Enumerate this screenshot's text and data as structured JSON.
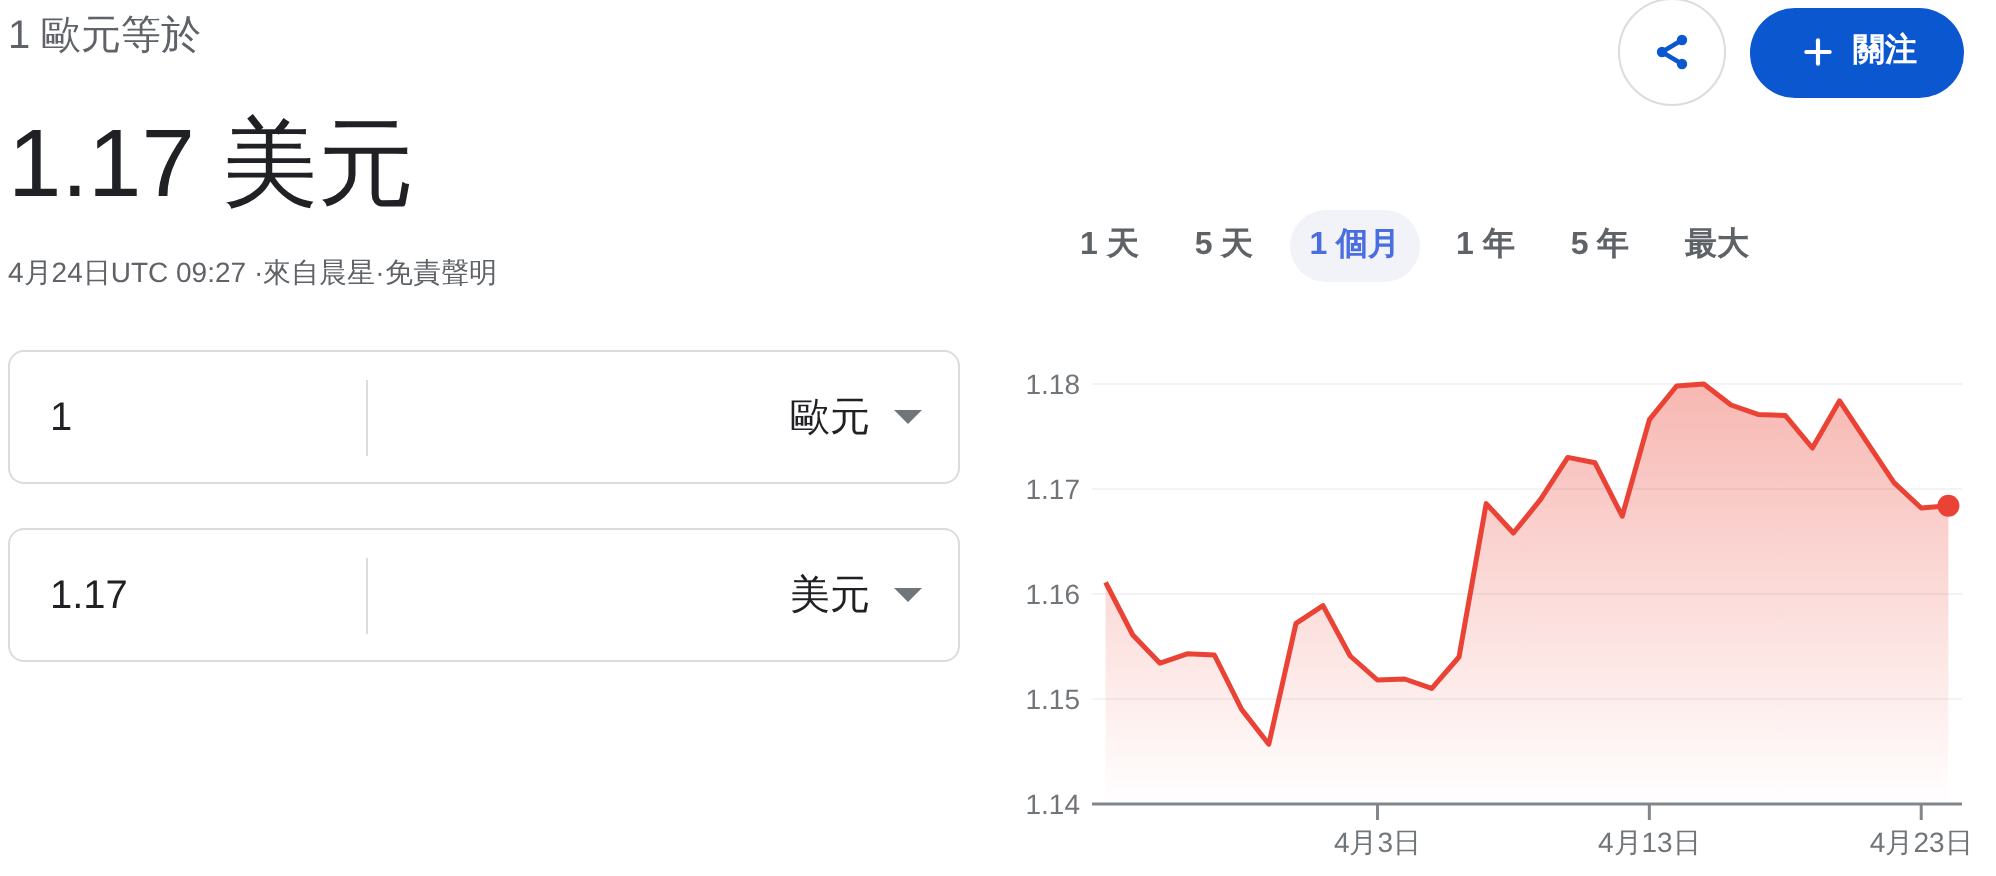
{
  "header": {
    "base_label": "1 歐元等於",
    "result": "1.17 美元",
    "meta": "4月24日UTC 09:27 ·來自晨星·免責聲明"
  },
  "actions": {
    "follow_button": "關注"
  },
  "converter": [
    {
      "amount": "1",
      "currency": "歐元"
    },
    {
      "amount": "1.17",
      "currency": "美元"
    }
  ],
  "ranges": [
    {
      "label": "1 天",
      "selected": false
    },
    {
      "label": "5 天",
      "selected": false
    },
    {
      "label": "1 個月",
      "selected": true
    },
    {
      "label": "1 年",
      "selected": false
    },
    {
      "label": "5 年",
      "selected": false
    },
    {
      "label": "最大",
      "selected": false
    }
  ],
  "chart_data": {
    "type": "area",
    "categories": [
      null,
      null,
      null,
      null,
      null,
      null,
      null,
      null,
      null,
      null,
      "4月3日",
      null,
      null,
      null,
      null,
      null,
      null,
      null,
      null,
      null,
      "4月13日",
      null,
      null,
      null,
      null,
      null,
      null,
      null,
      null,
      null,
      "4月23日",
      null
    ],
    "series": [
      {
        "color": "#ea4335",
        "values": [
          1.1611,
          1.1561,
          1.1534,
          1.1543,
          1.1542,
          1.149,
          1.1457,
          1.1572,
          1.1589,
          1.1541,
          1.1518,
          1.1519,
          1.151,
          1.154,
          1.1686,
          1.1658,
          1.169,
          1.173,
          1.1725,
          1.1674,
          1.1766,
          1.1798,
          1.18,
          1.178,
          1.1771,
          1.177,
          1.1739,
          1.1784,
          1.1745,
          1.1706,
          1.1682,
          1.1684
        ]
      }
    ],
    "ylim": [
      1.14,
      1.18
    ],
    "grid": true,
    "yticks": [
      {
        "value": 1.14,
        "label": "1.14"
      },
      {
        "value": 1.15,
        "label": "1.15"
      },
      {
        "value": 1.16,
        "label": "1.16"
      },
      {
        "value": 1.17,
        "label": "1.17"
      },
      {
        "value": 1.18,
        "label": "1.18"
      }
    ]
  }
}
